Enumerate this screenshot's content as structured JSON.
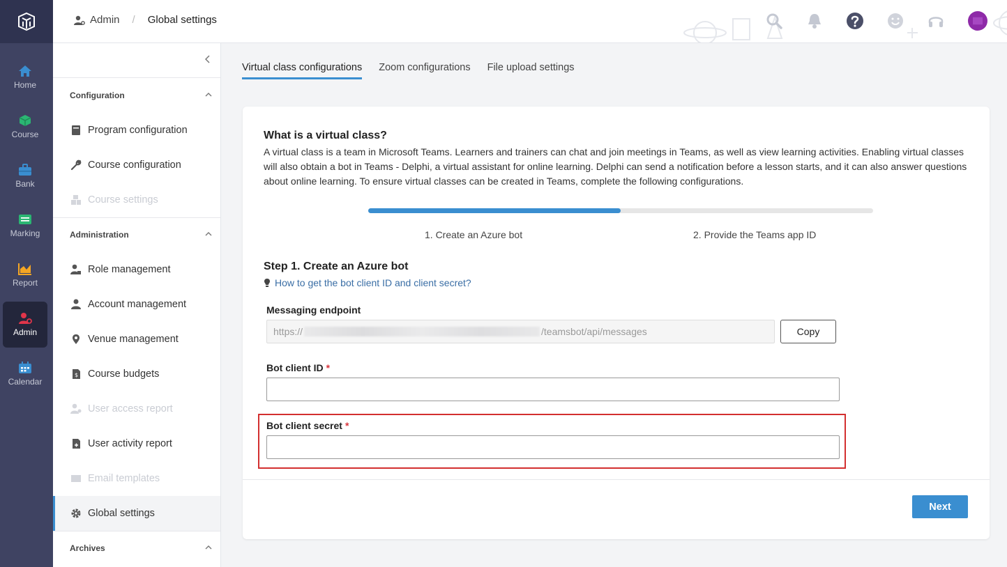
{
  "rail": {
    "items": [
      {
        "label": "Home"
      },
      {
        "label": "Course"
      },
      {
        "label": "Bank"
      },
      {
        "label": "Marking"
      },
      {
        "label": "Report"
      },
      {
        "label": "Admin"
      },
      {
        "label": "Calendar"
      }
    ]
  },
  "header": {
    "breadcrumb": {
      "parent": "Admin",
      "separator": "/",
      "current": "Global settings"
    }
  },
  "menu": {
    "sections": [
      {
        "title": "Configuration"
      },
      {
        "title": "Administration"
      },
      {
        "title": "Archives"
      }
    ],
    "items": [
      {
        "label": "Program configuration"
      },
      {
        "label": "Course configuration"
      },
      {
        "label": "Course settings"
      },
      {
        "label": "Role management"
      },
      {
        "label": "Account management"
      },
      {
        "label": "Venue management"
      },
      {
        "label": "Course budgets"
      },
      {
        "label": "User access report"
      },
      {
        "label": "User activity report"
      },
      {
        "label": "Email templates"
      },
      {
        "label": "Global settings"
      }
    ]
  },
  "tabs": [
    {
      "label": "Virtual class configurations"
    },
    {
      "label": "Zoom configurations"
    },
    {
      "label": "File upload settings"
    }
  ],
  "card": {
    "title": "What is a virtual class?",
    "description": "A virtual class is a team in Microsoft Teams. Learners and trainers can chat and join meetings in Teams, as well as view learning activities. Enabling virtual classes will also obtain a bot in Teams - Delphi, a virtual assistant for online learning. Delphi can send a notification before a lesson starts, and it can also answer questions about online learning. To ensure virtual classes can be created in Teams, complete the following configurations.",
    "progress": 0.5,
    "steps": [
      "1. Create an Azure bot",
      "2. Provide the Teams app ID"
    ],
    "step_title": "Step 1. Create an Azure bot",
    "help_link": "How to get the bot client ID and client secret?",
    "endpoint": {
      "label": "Messaging endpoint",
      "prefix": "https://",
      "suffix": "/teamsbot/api/messages",
      "copy": "Copy"
    },
    "client_id": {
      "label": "Bot client ID",
      "required": "*"
    },
    "client_secret": {
      "label": "Bot client secret",
      "required": "*"
    },
    "next": "Next"
  },
  "colors": {
    "accent": "#3a8ed0",
    "rail": "#3f4362",
    "highlight": "#d32f2f",
    "required": "#d9363e"
  }
}
